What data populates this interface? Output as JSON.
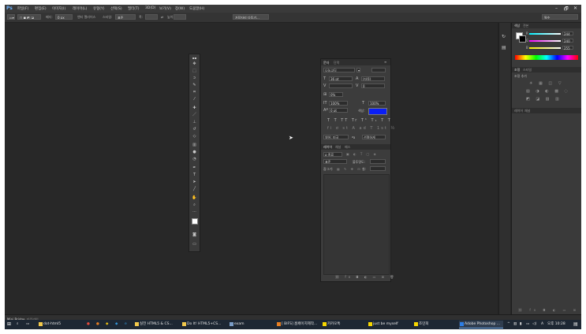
{
  "app": {
    "logo": "Ps",
    "menus": [
      "파일(F)",
      "편집(E)",
      "이미지(I)",
      "레이어(L)",
      "유형(Y)",
      "선택(S)",
      "필터(T)",
      "3D(D)",
      "보기(V)",
      "창(W)",
      "도움말(H)"
    ],
    "window_controls": [
      "–",
      "🗗",
      "✕"
    ]
  },
  "options_bar": {
    "feather_label": "페더:",
    "feather_value": "0 px",
    "antialias_label": "앤티 앨리어스",
    "style_label": "스타일:",
    "style_value": "표준",
    "width_label": "폭:",
    "height_label": "높이:",
    "refine_edge": "가장자리 다듬기...",
    "workspace": "필수"
  },
  "char_panel": {
    "tabs": [
      "문자",
      "단락"
    ],
    "font_family": "나눔고딕",
    "font_size": "36 pt",
    "leading": "(자동)",
    "kerning": "0",
    "tracking": "0%",
    "vscale": "100%",
    "hscale": "100%",
    "baseline": "0 pt",
    "color_label": "색상:",
    "color": "#0a1ef5",
    "language": "영어: 미국",
    "aa_prefix": "ªa",
    "aa_mode": "선명하게",
    "styles_tabs": [
      "레이어",
      "채널",
      "패스"
    ],
    "blend_mode": "표준",
    "opacity_label": "불투명도:",
    "lock_label": "잠그기:",
    "fill_label": "칠:"
  },
  "right_panels": {
    "color_tabs": [
      "색상",
      "견본"
    ],
    "r_label": "R",
    "r_value": "244",
    "g_label": "G",
    "g_value": "240",
    "b_label": "B",
    "b_value": "255",
    "adjust_tabs": [
      "조정",
      "스타일"
    ],
    "adjust_title": "조정 추가",
    "layers_tabs": [
      "레이어",
      "채널"
    ]
  },
  "status": {
    "tabs": [
      "Mini Bridge",
      "타임라인"
    ]
  },
  "taskbar": {
    "items": [
      {
        "label": "dot-html5",
        "color": "#f2c94c"
      },
      {
        "label": "실전 HTML5 & CS...",
        "color": "#f2c94c"
      },
      {
        "label": "Do It! HTML5+CS...",
        "color": "#f2c94c"
      },
      {
        "label": "exam",
        "color": "#7a9cc6"
      },
      {
        "label": "[ BIFS] 홈페이지제작...",
        "color": "#e67e22"
      },
      {
        "label": "카카오톡",
        "color": "#f7d700"
      },
      {
        "label": "just be myself",
        "color": "#f7d700"
      },
      {
        "label": "조민희",
        "color": "#f7d700"
      },
      {
        "label": "Adobe Photoshop ...",
        "color": "#2d7ee5"
      }
    ],
    "tray_time": "오후 10:28",
    "tray_lang": "A"
  },
  "colors": {
    "fg_swatch": "#ffffff",
    "bg_swatch": "#000000",
    "accent": "#2d7ee5"
  }
}
